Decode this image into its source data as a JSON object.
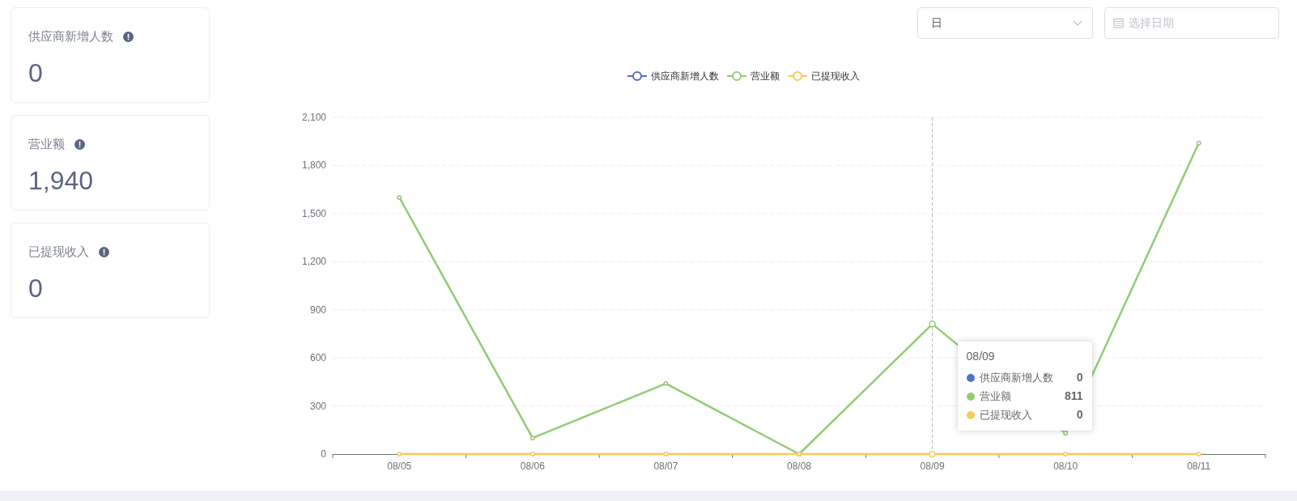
{
  "cards": [
    {
      "label": "供应商新增人数",
      "value": "0"
    },
    {
      "label": "营业额",
      "value": "1,940"
    },
    {
      "label": "已提现收入",
      "value": "0"
    }
  ],
  "period_select": {
    "value": "日"
  },
  "date_field": {
    "placeholder": "选择日期"
  },
  "chart": {
    "chart_data": {
      "type": "line",
      "categories": [
        "08/05",
        "08/06",
        "08/07",
        "08/08",
        "08/09",
        "08/10",
        "08/11"
      ],
      "series": [
        {
          "name": "供应商新增人数",
          "color": "#5470c6",
          "marker": "circle",
          "values": [
            null,
            null,
            null,
            null,
            null,
            null,
            null
          ]
        },
        {
          "name": "营业额",
          "color": "#91cc75",
          "marker": "circle",
          "values": [
            1600,
            100,
            440,
            0,
            811,
            130,
            1940
          ]
        },
        {
          "name": "已提现收入",
          "color": "#fac858",
          "marker": "circle",
          "values": [
            0,
            0,
            0,
            0,
            0,
            0,
            0
          ]
        }
      ],
      "grid": true,
      "legend": true,
      "ref_lines": [
        {
          "axis": "x",
          "value": "08/09"
        }
      ],
      "ylim": [
        0,
        2100
      ],
      "yticks": [
        {
          "value": 0,
          "label": "0"
        },
        {
          "value": 300,
          "label": "300"
        },
        {
          "value": 600,
          "label": "600"
        },
        {
          "value": 900,
          "label": "900"
        },
        {
          "value": 1200,
          "label": "1,200"
        },
        {
          "value": 1500,
          "label": "1,500"
        },
        {
          "value": 1800,
          "label": "1,800"
        },
        {
          "value": 2100,
          "label": "2,100"
        }
      ]
    },
    "tooltip": {
      "title": "08/09",
      "rows": [
        {
          "name": "供应商新增人数",
          "value": "0",
          "color": "#5470c6"
        },
        {
          "name": "营业额",
          "value": "811",
          "color": "#91cc75"
        },
        {
          "name": "已提现收入",
          "value": "0",
          "color": "#fac858"
        }
      ]
    }
  }
}
